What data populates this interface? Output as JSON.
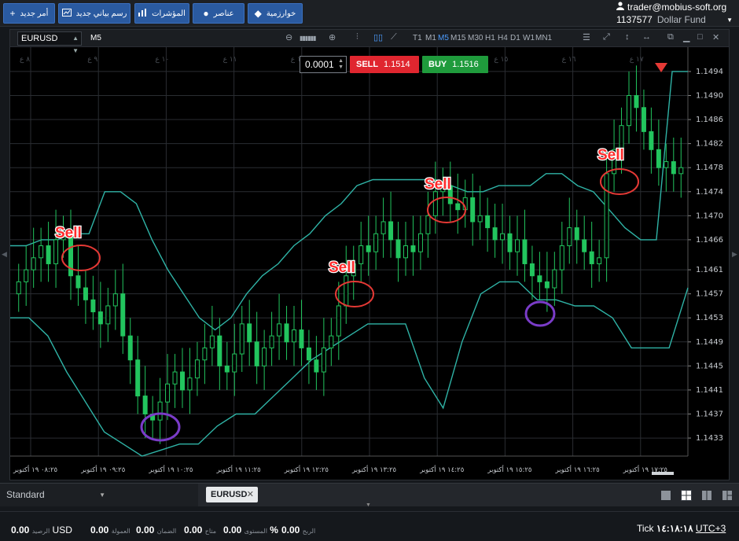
{
  "toolbar": {
    "buttons": [
      {
        "label": "أمر جديد",
        "icon": "plus-icon"
      },
      {
        "label": "رسم بياني جديد",
        "icon": "chart-icon"
      },
      {
        "label": "المؤشرات",
        "icon": "indicators-icon"
      },
      {
        "label": "عناصر",
        "icon": "elements-icon"
      },
      {
        "label": "خوارزمية",
        "icon": "algorithm-icon"
      }
    ]
  },
  "account": {
    "email": "trader@mobius-soft.org",
    "balance": "1137577",
    "fund_label": "Dollar Fund"
  },
  "chart_window": {
    "symbol": "EURUSD",
    "timeframe_current": "M5",
    "timeframes": [
      "T1",
      "M1",
      "M5",
      "M15",
      "M30",
      "H1",
      "H4",
      "D1",
      "W1",
      "MN1"
    ],
    "active_timeframe": "M5"
  },
  "trade_panel": {
    "volume": "0.0001",
    "sell_label": "SELL",
    "sell_price": "1.1514",
    "buy_label": "BUY",
    "buy_price": "1.1516"
  },
  "chart_data": {
    "type": "candlestick",
    "symbol": "EURUSD",
    "timeframe": "M5",
    "ylim": [
      1.143,
      1.1497
    ],
    "y_ticks": [
      "1.1494",
      "1.1490",
      "1.1486",
      "1.1482",
      "1.1478",
      "1.1474",
      "1.1470",
      "1.1466",
      "1.1461",
      "1.1457",
      "1.1453",
      "1.1449",
      "1.1445",
      "1.1441",
      "1.1437",
      "1.1433"
    ],
    "x_ticks": [
      "٠٨:٢٥ ١٩ أكتوبر",
      "٠٩:٢٥ ١٩ أكتوبر",
      "١٠:٢٥ ١٩ أكتوبر",
      "١١:٢٥ ١٩ أكتوبر",
      "١٢:٢٥ ١٩ أكتوبر",
      "١٣:٢٥ ١٩ أكتوبر",
      "١٤:٢٥ ١٩ أكتوبر",
      "١٥:٢٥ ١٩ أكتوبر",
      "١٦:٢٥ ١٩ أكتوبر",
      "١٧:٢٥ ١٩ أكتوبر"
    ],
    "top_hour_labels": [
      "٨ ع",
      "٩ ع",
      "١٠ ع",
      "١١ ع",
      "١٢ ع",
      "١٣ ع",
      "١٤ ع",
      "١٥ ع",
      "١٦ ع",
      "١٧ ع"
    ],
    "closes": [
      1.1459,
      1.1461,
      1.1463,
      1.1465,
      1.1462,
      1.1466,
      1.1467,
      1.146,
      1.1458,
      1.1456,
      1.1454,
      1.1452,
      1.1455,
      1.1457,
      1.145,
      1.1446,
      1.144,
      1.1437,
      1.1436,
      1.1439,
      1.1442,
      1.1444,
      1.1441,
      1.1443,
      1.1446,
      1.1448,
      1.145,
      1.1445,
      1.1444,
      1.1447,
      1.1452,
      1.1449,
      1.1445,
      1.1448,
      1.145,
      1.1452,
      1.1449,
      1.1451,
      1.1448,
      1.1446,
      1.1444,
      1.1448,
      1.145,
      1.1455,
      1.146,
      1.1462,
      1.1465,
      1.1464,
      1.1467,
      1.1469,
      1.1466,
      1.1463,
      1.1465,
      1.1464,
      1.1467,
      1.147,
      1.1474,
      1.1475,
      1.1472,
      1.1471,
      1.1473,
      1.1469,
      1.147,
      1.1468,
      1.1466,
      1.1467,
      1.1464,
      1.1466,
      1.1462,
      1.146,
      1.1459,
      1.1458,
      1.1461,
      1.1465,
      1.1468,
      1.1466,
      1.1464,
      1.1462,
      1.1463,
      1.1477,
      1.1481,
      1.1485,
      1.149,
      1.1488,
      1.1484,
      1.1481,
      1.1478,
      1.1479,
      1.1477,
      1.1478
    ],
    "upper_band": [
      1.1465,
      1.1465,
      1.1466,
      1.1466,
      1.1467,
      1.1467,
      1.1474,
      1.1474,
      1.1472,
      1.1466,
      1.1461,
      1.1457,
      1.1453,
      1.1451,
      1.1453,
      1.1457,
      1.146,
      1.1462,
      1.1465,
      1.1467,
      1.147,
      1.1472,
      1.1475,
      1.1476,
      1.1476,
      1.1476,
      1.1476,
      1.1476,
      1.1475,
      1.1474,
      1.1474,
      1.1475,
      1.1475,
      1.1475,
      1.1477,
      1.1477,
      1.1475,
      1.1474,
      1.1471,
      1.1468,
      1.1466,
      1.1466,
      1.1494,
      1.1494
    ],
    "lower_band": [
      1.1453,
      1.1453,
      1.145,
      1.1444,
      1.1439,
      1.1434,
      1.1432,
      1.143,
      1.1431,
      1.1432,
      1.1432,
      1.1435,
      1.1437,
      1.1437,
      1.144,
      1.1443,
      1.1446,
      1.1448,
      1.145,
      1.1452,
      1.1452,
      1.1452,
      1.1443,
      1.1438,
      1.1449,
      1.1457,
      1.1459,
      1.1459,
      1.1456,
      1.1456,
      1.1455,
      1.1455,
      1.1453,
      1.1448,
      1.1448,
      1.1448,
      1.1458
    ],
    "signal_labels": [
      "Sell",
      "Sell",
      "Sell",
      "Sell"
    ],
    "current_price": "1.1478"
  },
  "bottom_tabs": {
    "layout_name": "Standard",
    "symbol_tab": "EURUSD"
  },
  "status": {
    "balance_value": "0.00",
    "balance_label": "الرصيد",
    "currency": "USD",
    "commission_value": "0.00",
    "commission_label": "العمولة",
    "collateral_value": "0.00",
    "collateral_label": "الضمان",
    "available_label": "متاح",
    "level_value": "0.00",
    "level_label": "المستوى",
    "level_unit": "%",
    "profit_value": "0.00",
    "profit_label": "الربح",
    "tick_label": "Tick",
    "time": "١٤:١٨:١٨",
    "timezone": "UTC+3"
  }
}
